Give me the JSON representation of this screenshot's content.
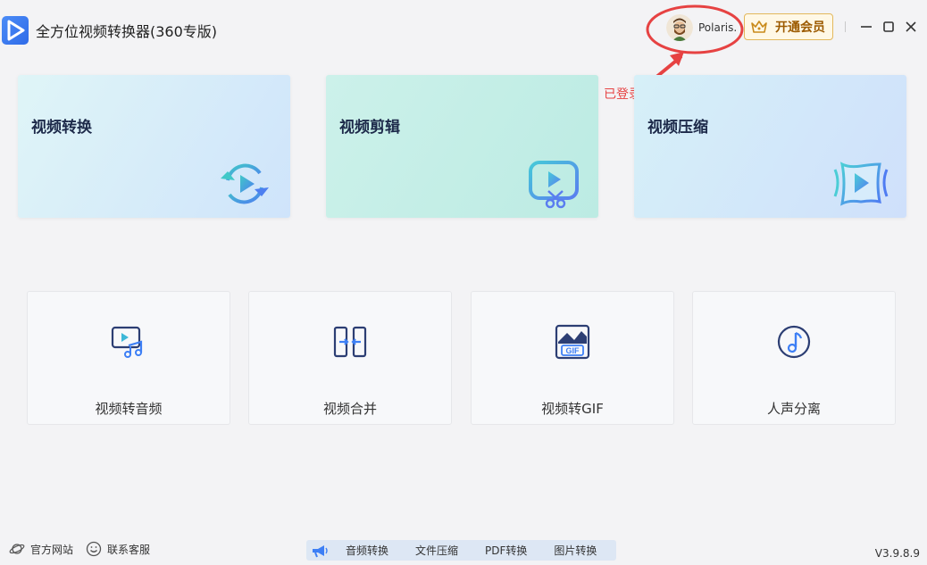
{
  "app": {
    "title": "全方位视频转换器(360专版)"
  },
  "user": {
    "name": "Polaris."
  },
  "vip": {
    "label": "开通会员"
  },
  "annotation": {
    "text": "已登录的状态",
    "color": "#e64242"
  },
  "feature_cards": [
    {
      "title": "视频转换",
      "icon": "convert-cycle-icon"
    },
    {
      "title": "视频剪辑",
      "icon": "video-scissors-icon"
    },
    {
      "title": "视频压缩",
      "icon": "compress-icon"
    }
  ],
  "tools": [
    {
      "label": "视频转音频",
      "icon": "video-to-audio-icon"
    },
    {
      "label": "视频合并",
      "icon": "merge-icon"
    },
    {
      "label": "视频转GIF",
      "icon": "gif-icon"
    },
    {
      "label": "人声分离",
      "icon": "music-note-icon"
    }
  ],
  "footer": {
    "website": "官方网站",
    "support": "联系客服",
    "bar_items": [
      "音频转换",
      "文件压缩",
      "PDF转换",
      "图片转换"
    ],
    "version": "V3.9.8.9"
  },
  "colors": {
    "accent": "#3d7ff5",
    "vip_text": "#9c5a00",
    "icon_dark": "#2c3e73"
  }
}
